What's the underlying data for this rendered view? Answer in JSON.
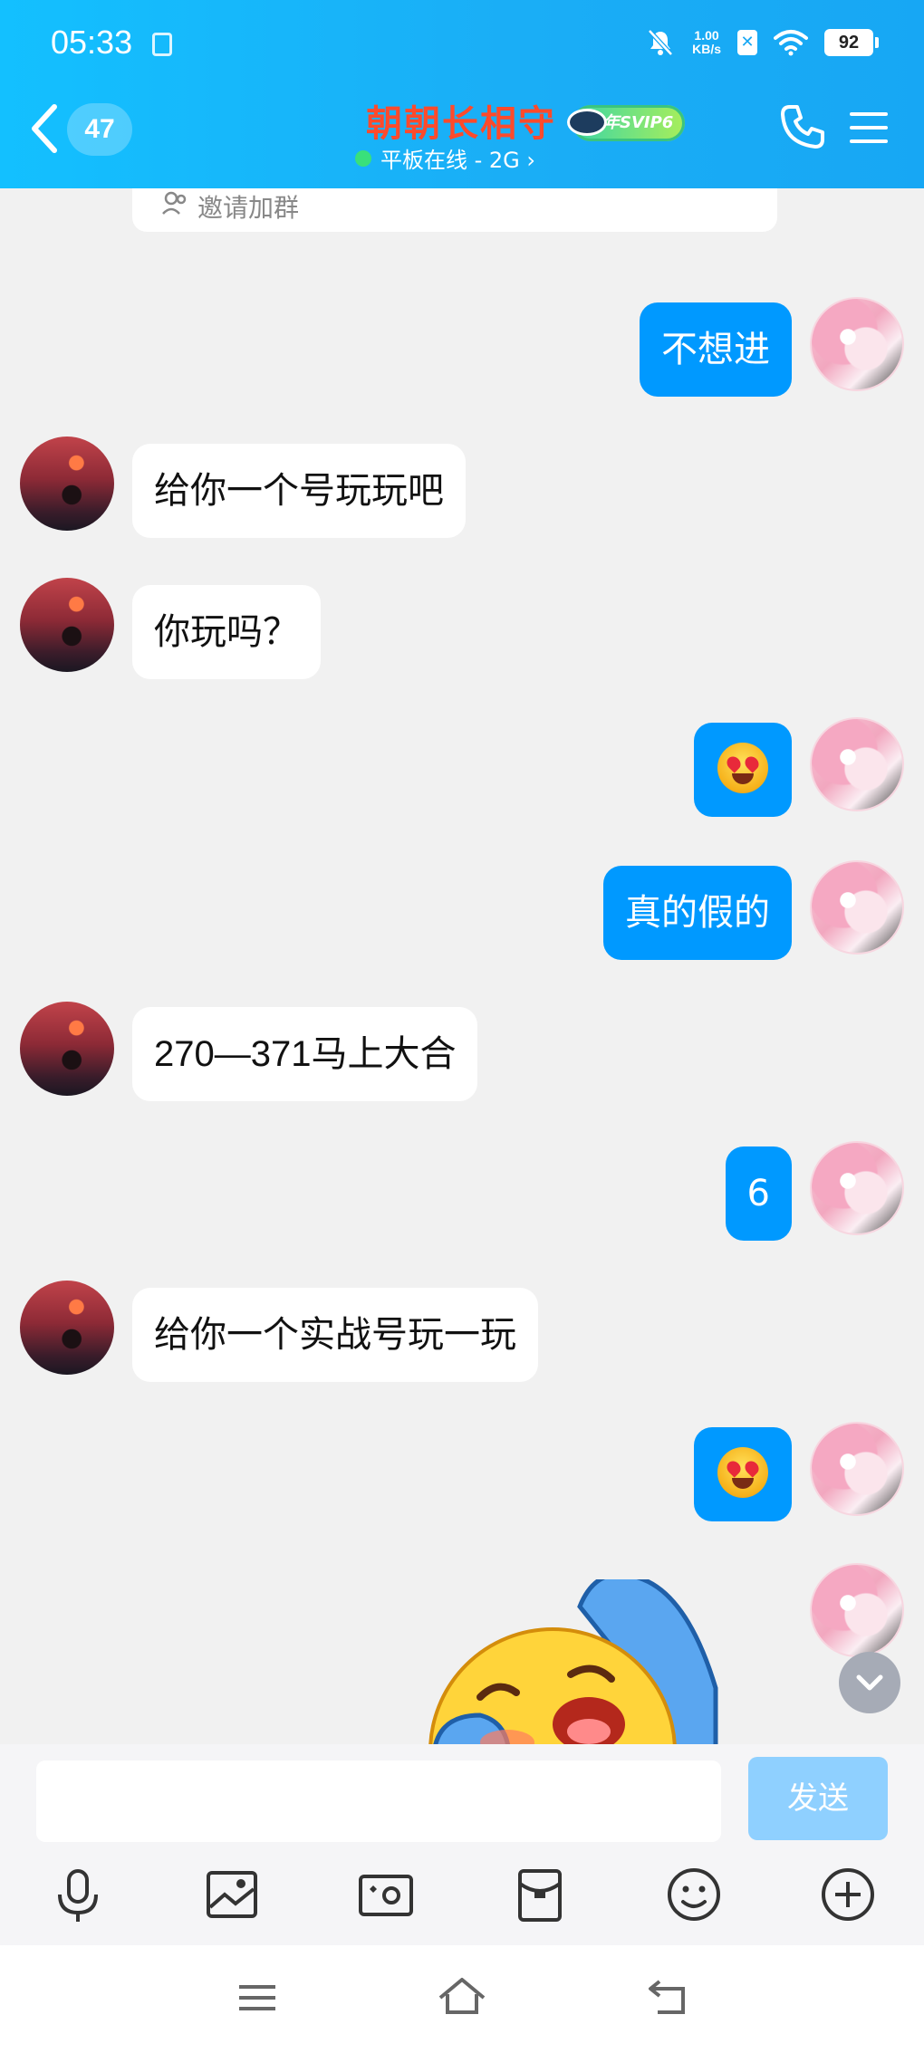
{
  "status_bar": {
    "time": "05:33",
    "net_speed_value": "1.00",
    "net_speed_unit": "KB/s",
    "x_badge": "✕",
    "battery": "92"
  },
  "header": {
    "back_badge": "47",
    "title": "朝朝长相守",
    "svip_label": "年SVIP6",
    "online_status": "平板在线 - 2G ›"
  },
  "chat": {
    "invite_text": "邀请加群",
    "messages": [
      {
        "from": "me",
        "text": "不想进"
      },
      {
        "from": "other",
        "text": "给你一个号玩玩吧"
      },
      {
        "from": "other",
        "text": "你玩吗？"
      },
      {
        "from": "me",
        "emoji": "heart-eyes-emoji"
      },
      {
        "from": "me",
        "text": "真的假的"
      },
      {
        "from": "other",
        "text": "270—371马上大合"
      },
      {
        "from": "me",
        "text": "6"
      },
      {
        "from": "other",
        "text": "给你一个实战号玩一玩"
      },
      {
        "from": "me",
        "emoji": "heart-eyes-emoji"
      },
      {
        "from": "me",
        "sticker": "laughing-duck-sticker"
      }
    ]
  },
  "input": {
    "placeholder": "",
    "send_label": "发送"
  },
  "toolbar_icons": [
    "microphone-icon",
    "image-icon",
    "camera-icon",
    "red-packet-icon",
    "smiley-icon",
    "plus-icon"
  ],
  "nav_icons": [
    "recents-icon",
    "home-icon",
    "back-icon"
  ],
  "colors": {
    "header_accent": "#17a7f4",
    "bubble_me": "#0099ff",
    "bubble_other": "#ffffff",
    "title_red": "#ff4a2b",
    "send_disabled": "#8fd0ff"
  }
}
